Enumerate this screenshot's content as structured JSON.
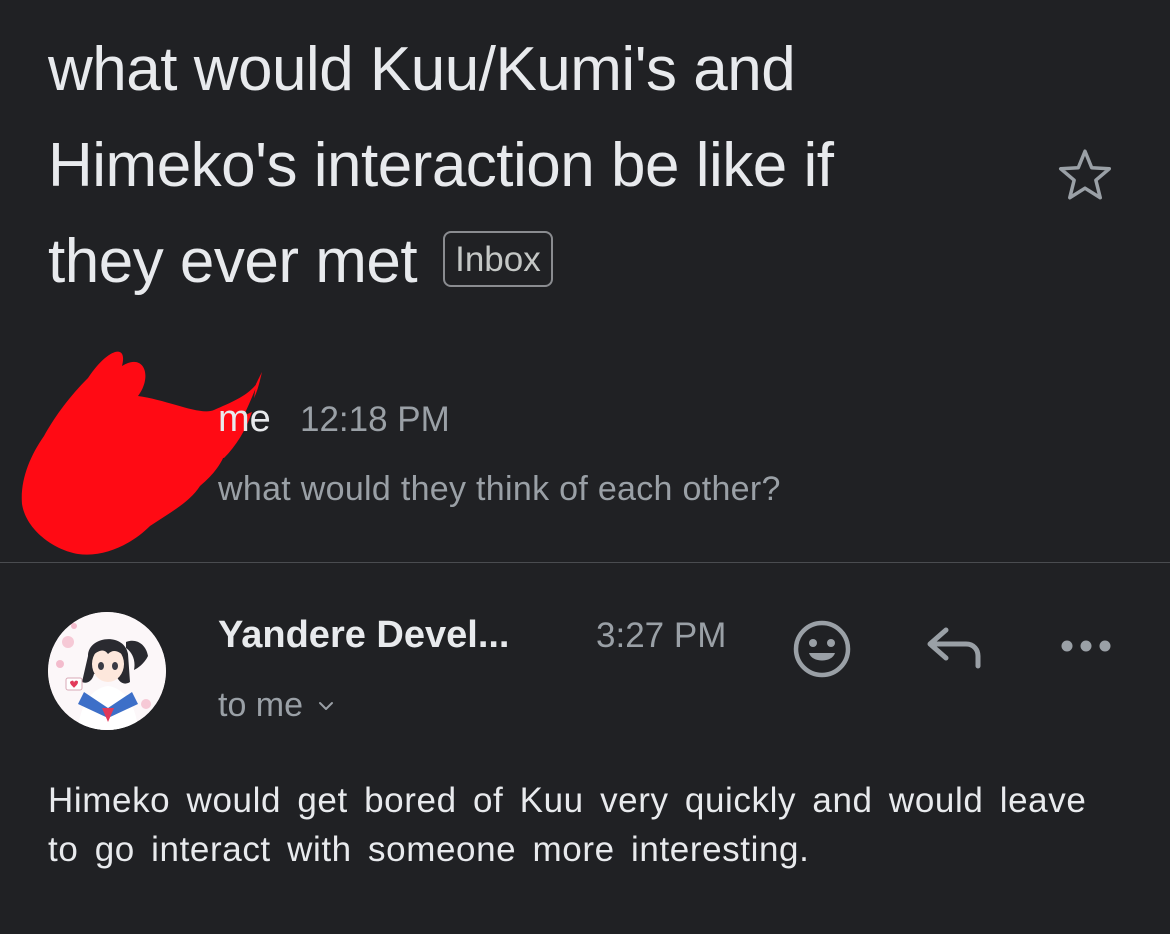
{
  "thread": {
    "subject_lines": [
      "what would Kuu/Kumi's and",
      "Himeko's interaction be like if",
      "they ever met"
    ],
    "label": "Inbox",
    "star_icon": "star-outline-icon"
  },
  "messages": [
    {
      "sender": "me",
      "time": "12:18 PM",
      "snippet": "what would they think of each other?",
      "avatar_icon": "redacted-avatar",
      "redaction_color": "#ff0a14"
    },
    {
      "sender": "Yandere Devel...",
      "time": "3:27 PM",
      "recipient": "to me",
      "avatar_icon": "anime-schoolgirl-avatar",
      "actions": {
        "react_icon": "add-reaction-icon",
        "reply_icon": "reply-icon",
        "more_icon": "more-horizontal-icon"
      },
      "body": "Himeko would get bored of Kuu very quickly and would leave to go interact with someone more interesting."
    }
  ],
  "colors": {
    "background": "#202124",
    "primary_text": "#e8eaed",
    "secondary_text": "#9aa0a6",
    "divider": "#4a4c50"
  }
}
